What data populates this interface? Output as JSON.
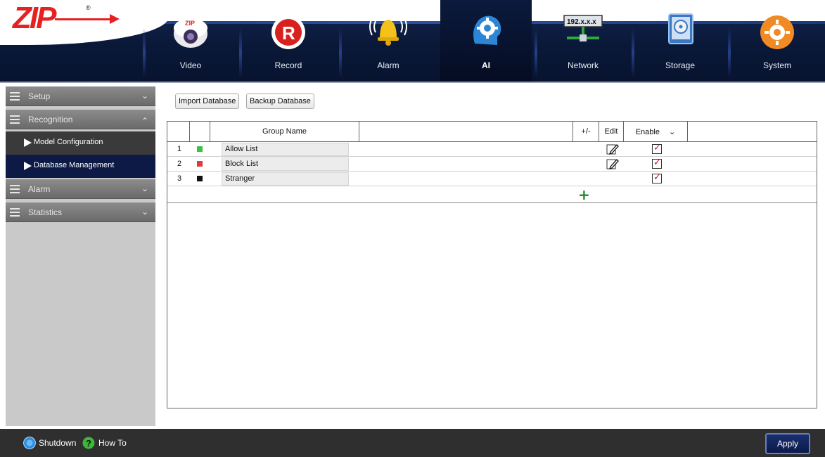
{
  "header": {
    "logo_text": "ZIP",
    "logo_mark": "®",
    "nav": [
      {
        "label": "Video",
        "icon": "camera-icon"
      },
      {
        "label": "Record",
        "icon": "record-icon"
      },
      {
        "label": "Alarm",
        "icon": "bell-icon"
      },
      {
        "label": "AI",
        "icon": "ai-gear-head-icon",
        "active": true
      },
      {
        "label": "Network",
        "icon": "network-icon",
        "badge": "192.x.x.x"
      },
      {
        "label": "Storage",
        "icon": "hard-drive-icon"
      },
      {
        "label": "System",
        "icon": "system-gear-icon"
      }
    ]
  },
  "sidebar": {
    "sections": [
      {
        "label": "Setup",
        "expanded": false
      },
      {
        "label": "Recognition",
        "expanded": true
      },
      {
        "label": "Alarm",
        "expanded": false
      },
      {
        "label": "Statistics",
        "expanded": false
      }
    ],
    "items": [
      {
        "label": "Model Configuration",
        "active": false
      },
      {
        "label": "Database Management",
        "active": true
      }
    ]
  },
  "toolbar": {
    "import_label": "Import Database",
    "backup_label": "Backup Database"
  },
  "table": {
    "headers": {
      "group_name": "Group Name",
      "plusminus": "+/-",
      "edit": "Edit",
      "enable": "Enable"
    },
    "rows": [
      {
        "num": "1",
        "color": "#39c24a",
        "name": "Allow List",
        "editable": true,
        "enabled": true
      },
      {
        "num": "2",
        "color": "#e03a3a",
        "name": "Block List",
        "editable": true,
        "enabled": true
      },
      {
        "num": "3",
        "color": "#111111",
        "name": "Stranger",
        "editable": false,
        "enabled": true
      }
    ],
    "add_symbol": "+"
  },
  "footer": {
    "shutdown_label": "Shutdown",
    "howto_label": "How To",
    "apply_label": "Apply"
  },
  "colors": {
    "accent_red": "#e52221",
    "nav_bg": "#0a1838",
    "active_item_bg": "#0d1a45",
    "add_green": "#1a8a2a"
  }
}
